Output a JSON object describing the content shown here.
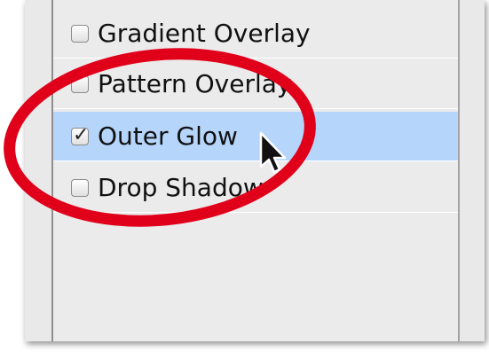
{
  "layer_styles": {
    "items": [
      {
        "label": "Gradient Overlay",
        "checked": false,
        "selected": false
      },
      {
        "label": "Pattern Overlay",
        "checked": false,
        "selected": false
      },
      {
        "label": "Outer Glow",
        "checked": true,
        "selected": true
      },
      {
        "label": "Drop Shadow",
        "checked": false,
        "selected": false
      }
    ],
    "check_glyph": "✓"
  },
  "colors": {
    "selection_highlight": "#b6d5fb",
    "annotation_ring": "#e1001a"
  },
  "icons": {
    "cursor": "arrow-cursor-icon"
  }
}
